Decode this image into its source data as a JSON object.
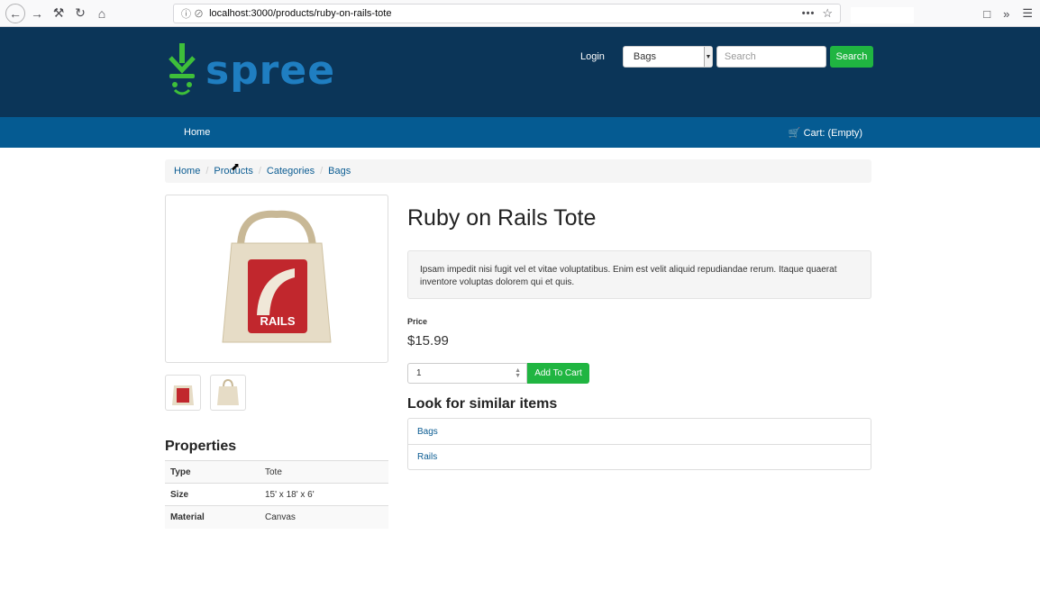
{
  "browser": {
    "url": "localhost:3000/products/ruby-on-rails-tote"
  },
  "header": {
    "logo_text": "spree",
    "login": "Login",
    "category_selected": "Bags",
    "search_placeholder": "Search",
    "search_button": "Search"
  },
  "nav": {
    "home": "Home",
    "cart": "Cart: (Empty)"
  },
  "breadcrumb": [
    "Home",
    "Products",
    "Categories",
    "Bags"
  ],
  "product": {
    "title": "Ruby on Rails Tote",
    "description": "Ipsam impedit nisi fugit vel et vitae voluptatibus. Enim est velit aliquid repudiandae rerum. Itaque quaerat inventore voluptas dolorem qui et quis.",
    "price_label": "Price",
    "price": "$15.99",
    "quantity": "1",
    "add_to_cart": "Add To Cart",
    "image_text": "RAILS"
  },
  "properties": {
    "title": "Properties",
    "rows": [
      {
        "key": "Type",
        "value": "Tote"
      },
      {
        "key": "Size",
        "value": "15' x 18' x 6'"
      },
      {
        "key": "Material",
        "value": "Canvas"
      }
    ]
  },
  "similar": {
    "title": "Look for similar items",
    "items": [
      "Bags",
      "Rails"
    ]
  },
  "colors": {
    "header_bg": "#0b3558",
    "nav_bg": "#055b92",
    "accent_green": "#20b541",
    "link": "#0b5c92"
  }
}
